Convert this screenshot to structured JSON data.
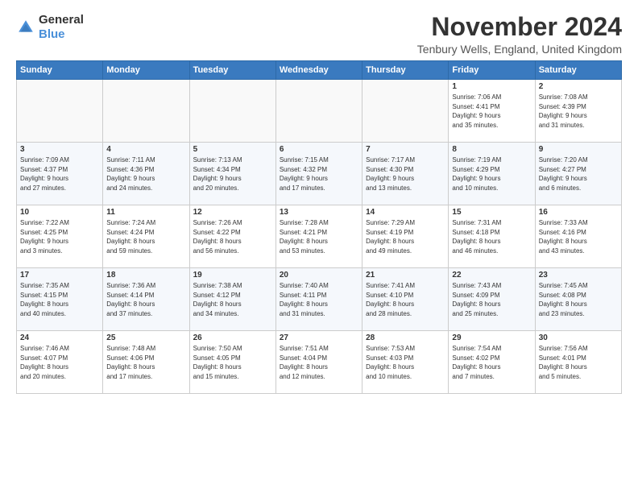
{
  "logo": {
    "line1": "General",
    "line2": "Blue"
  },
  "title": "November 2024",
  "subtitle": "Tenbury Wells, England, United Kingdom",
  "days_header": [
    "Sunday",
    "Monday",
    "Tuesday",
    "Wednesday",
    "Thursday",
    "Friday",
    "Saturday"
  ],
  "weeks": [
    [
      {
        "day": "",
        "info": ""
      },
      {
        "day": "",
        "info": ""
      },
      {
        "day": "",
        "info": ""
      },
      {
        "day": "",
        "info": ""
      },
      {
        "day": "",
        "info": ""
      },
      {
        "day": "1",
        "info": "Sunrise: 7:06 AM\nSunset: 4:41 PM\nDaylight: 9 hours\nand 35 minutes."
      },
      {
        "day": "2",
        "info": "Sunrise: 7:08 AM\nSunset: 4:39 PM\nDaylight: 9 hours\nand 31 minutes."
      }
    ],
    [
      {
        "day": "3",
        "info": "Sunrise: 7:09 AM\nSunset: 4:37 PM\nDaylight: 9 hours\nand 27 minutes."
      },
      {
        "day": "4",
        "info": "Sunrise: 7:11 AM\nSunset: 4:36 PM\nDaylight: 9 hours\nand 24 minutes."
      },
      {
        "day": "5",
        "info": "Sunrise: 7:13 AM\nSunset: 4:34 PM\nDaylight: 9 hours\nand 20 minutes."
      },
      {
        "day": "6",
        "info": "Sunrise: 7:15 AM\nSunset: 4:32 PM\nDaylight: 9 hours\nand 17 minutes."
      },
      {
        "day": "7",
        "info": "Sunrise: 7:17 AM\nSunset: 4:30 PM\nDaylight: 9 hours\nand 13 minutes."
      },
      {
        "day": "8",
        "info": "Sunrise: 7:19 AM\nSunset: 4:29 PM\nDaylight: 9 hours\nand 10 minutes."
      },
      {
        "day": "9",
        "info": "Sunrise: 7:20 AM\nSunset: 4:27 PM\nDaylight: 9 hours\nand 6 minutes."
      }
    ],
    [
      {
        "day": "10",
        "info": "Sunrise: 7:22 AM\nSunset: 4:25 PM\nDaylight: 9 hours\nand 3 minutes."
      },
      {
        "day": "11",
        "info": "Sunrise: 7:24 AM\nSunset: 4:24 PM\nDaylight: 8 hours\nand 59 minutes."
      },
      {
        "day": "12",
        "info": "Sunrise: 7:26 AM\nSunset: 4:22 PM\nDaylight: 8 hours\nand 56 minutes."
      },
      {
        "day": "13",
        "info": "Sunrise: 7:28 AM\nSunset: 4:21 PM\nDaylight: 8 hours\nand 53 minutes."
      },
      {
        "day": "14",
        "info": "Sunrise: 7:29 AM\nSunset: 4:19 PM\nDaylight: 8 hours\nand 49 minutes."
      },
      {
        "day": "15",
        "info": "Sunrise: 7:31 AM\nSunset: 4:18 PM\nDaylight: 8 hours\nand 46 minutes."
      },
      {
        "day": "16",
        "info": "Sunrise: 7:33 AM\nSunset: 4:16 PM\nDaylight: 8 hours\nand 43 minutes."
      }
    ],
    [
      {
        "day": "17",
        "info": "Sunrise: 7:35 AM\nSunset: 4:15 PM\nDaylight: 8 hours\nand 40 minutes."
      },
      {
        "day": "18",
        "info": "Sunrise: 7:36 AM\nSunset: 4:14 PM\nDaylight: 8 hours\nand 37 minutes."
      },
      {
        "day": "19",
        "info": "Sunrise: 7:38 AM\nSunset: 4:12 PM\nDaylight: 8 hours\nand 34 minutes."
      },
      {
        "day": "20",
        "info": "Sunrise: 7:40 AM\nSunset: 4:11 PM\nDaylight: 8 hours\nand 31 minutes."
      },
      {
        "day": "21",
        "info": "Sunrise: 7:41 AM\nSunset: 4:10 PM\nDaylight: 8 hours\nand 28 minutes."
      },
      {
        "day": "22",
        "info": "Sunrise: 7:43 AM\nSunset: 4:09 PM\nDaylight: 8 hours\nand 25 minutes."
      },
      {
        "day": "23",
        "info": "Sunrise: 7:45 AM\nSunset: 4:08 PM\nDaylight: 8 hours\nand 23 minutes."
      }
    ],
    [
      {
        "day": "24",
        "info": "Sunrise: 7:46 AM\nSunset: 4:07 PM\nDaylight: 8 hours\nand 20 minutes."
      },
      {
        "day": "25",
        "info": "Sunrise: 7:48 AM\nSunset: 4:06 PM\nDaylight: 8 hours\nand 17 minutes."
      },
      {
        "day": "26",
        "info": "Sunrise: 7:50 AM\nSunset: 4:05 PM\nDaylight: 8 hours\nand 15 minutes."
      },
      {
        "day": "27",
        "info": "Sunrise: 7:51 AM\nSunset: 4:04 PM\nDaylight: 8 hours\nand 12 minutes."
      },
      {
        "day": "28",
        "info": "Sunrise: 7:53 AM\nSunset: 4:03 PM\nDaylight: 8 hours\nand 10 minutes."
      },
      {
        "day": "29",
        "info": "Sunrise: 7:54 AM\nSunset: 4:02 PM\nDaylight: 8 hours\nand 7 minutes."
      },
      {
        "day": "30",
        "info": "Sunrise: 7:56 AM\nSunset: 4:01 PM\nDaylight: 8 hours\nand 5 minutes."
      }
    ]
  ]
}
